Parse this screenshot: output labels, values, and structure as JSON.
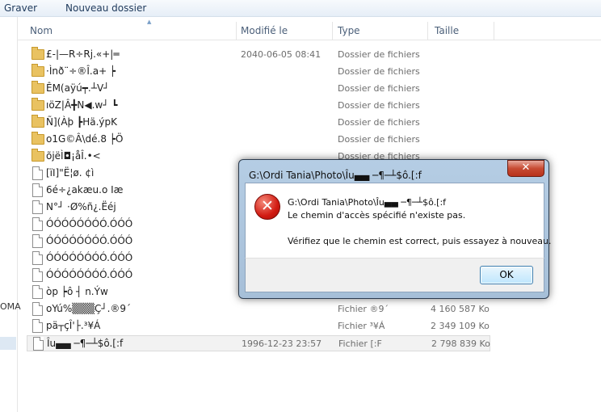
{
  "toolbar": {
    "graver": "Graver",
    "new_folder": "Nouveau dossier"
  },
  "left_pane": {
    "partial_text": "OMA"
  },
  "columns": {
    "name": "Nom",
    "modified": "Modifié le",
    "type": "Type",
    "size": "Taille"
  },
  "rows": [
    {
      "name": "£-|—R÷Rj.«+|═",
      "date": "2040-06-05 08:41",
      "type": "Dossier de fichiers",
      "size": "",
      "icon": "folder-icon"
    },
    {
      "name": "·Ìnð¨÷®Î.a+ ┝",
      "date": "",
      "type": "Dossier de fichiers",
      "size": "",
      "icon": "folder-icon"
    },
    {
      "name": "ÊM(aÿú┯.┴V┘",
      "date": "",
      "type": "Dossier de fichiers",
      "size": "",
      "icon": "folder-icon"
    },
    {
      "name": "ıöZ|Â╋N◀.w┘ ┗",
      "date": "",
      "type": "Dossier de fichiers",
      "size": "",
      "icon": "folder-icon"
    },
    {
      "name": "Ñ](Àþ ┣Hä.ýpK",
      "date": "",
      "type": "Dossier de fichiers",
      "size": "",
      "icon": "folder-icon"
    },
    {
      "name": "o1G©Â\\dé.8 ┝Ö",
      "date": "",
      "type": "Dossier de fichiers",
      "size": "",
      "icon": "folder-icon"
    },
    {
      "name": "õjëÌ◘¡åÎ.•<",
      "date": "",
      "type": "Dossier de fichiers",
      "size": "",
      "icon": "folder-icon"
    },
    {
      "name": "[ïI]\"Ë¦ø. ¢ì",
      "date": "",
      "type": "",
      "size": "",
      "icon": "file-icon"
    },
    {
      "name": "6é÷¿akæu.o Iæ",
      "date": "",
      "type": "",
      "size": "",
      "icon": "file-icon"
    },
    {
      "name": "N°┘ ·Ø%ñ¿.Ëéj",
      "date": "",
      "type": "",
      "size": "",
      "icon": "file-icon"
    },
    {
      "name": "ÓÓÓÓÓÓÓÓ.ÓÓÓ",
      "date": "",
      "type": "",
      "size": "",
      "icon": "file-icon"
    },
    {
      "name": "ÓÓÓÓÓÓÓÓ.ÓÓÓ",
      "date": "",
      "type": "",
      "size": "",
      "icon": "file-icon"
    },
    {
      "name": "ÓÓÓÓÓÓÓÓ.ÓÓÓ",
      "date": "",
      "type": "",
      "size": "",
      "icon": "file-icon"
    },
    {
      "name": "ÓÓÓÓÓÓÓÓ.ÓÓÓ",
      "date": "",
      "type": "",
      "size": "",
      "icon": "file-icon"
    },
    {
      "name": "òp ┝ô ┤ n.Ýw",
      "date": "",
      "type": "",
      "size": "",
      "icon": "file-icon"
    },
    {
      "name": "oYú%▒▒▒Ç┘.®9´",
      "date": "",
      "type": "Fichier ®9´",
      "size": "4 160 587 Ko",
      "icon": "file-icon"
    },
    {
      "name": "pä┬ç‌Î'├.³¥Á",
      "date": "",
      "type": "Fichier ³¥Á",
      "size": "2 349 109 Ko",
      "icon": "file-icon"
    },
    {
      "name": "Îu▄▄ ─¶─┴$ô.[:f",
      "date": "1996-12-23 23:57",
      "type": "Fichier [:F",
      "size": "2 798 839 Ko",
      "icon": "file-icon"
    }
  ],
  "dialog": {
    "title": "G:\\Ordi Tania\\Photo\\Îu▄▄ ─¶─┴$ô.[:f",
    "close_label": "✕",
    "path_line": "G:\\Ordi Tania\\Photo\\Îu▄▄ ─¶─┴$ô.[:f",
    "error_line": "Le chemin d'accès spécifié n'existe pas.",
    "advice_line": "Vérifiez que le chemin est correct, puis essayez à nouveau.",
    "ok_label": "OK",
    "icon": "error-icon"
  }
}
